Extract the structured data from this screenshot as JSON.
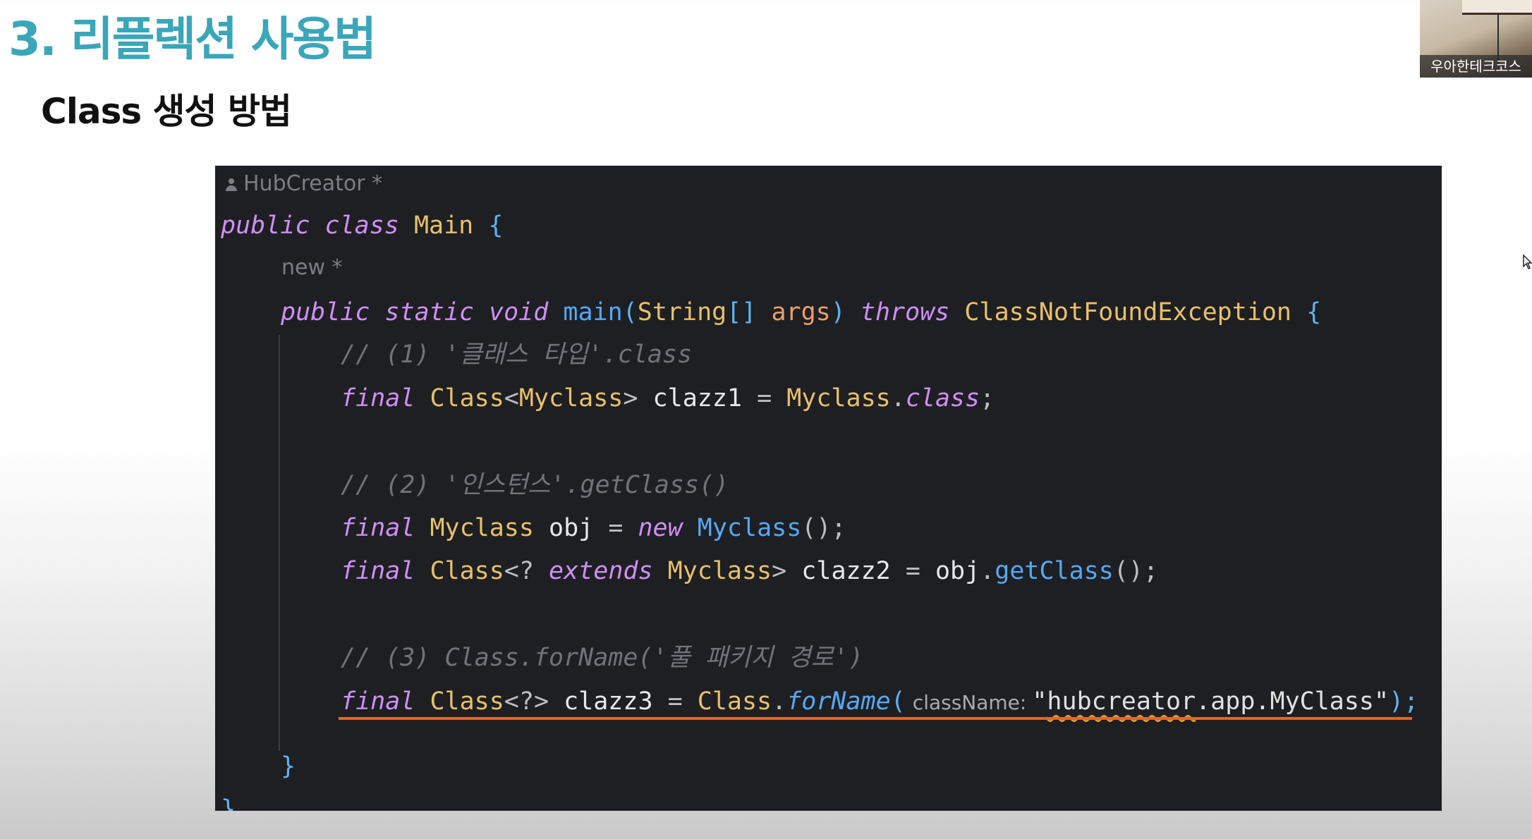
{
  "slide": {
    "title": "3. 리플렉션 사용법",
    "subtitle": "Class 생성 방법"
  },
  "webcam": {
    "label": "우아한테크코스"
  },
  "editor": {
    "author_hint": "HubCreator *",
    "method_hint": "new *",
    "line1": {
      "kw1": "public",
      "kw2": "class",
      "name": "Main",
      "brace": "{"
    },
    "line2": {
      "kw1": "public",
      "kw2": "static",
      "kw3": "void",
      "name": "main",
      "paren_open": "(",
      "type": "String",
      "arr": "[]",
      "param": "args",
      "paren_close": ")",
      "throws": "throws",
      "exc": "ClassNotFoundException",
      "brace": "{"
    },
    "comment1": "// (1) '클래스 타입'.class",
    "line3": {
      "final": "final",
      "type": "Class",
      "lt": "<",
      "generic": "Myclass",
      "gt": ">",
      "var": "clazz1",
      "eq": "=",
      "cls": "Myclass",
      "dot": ".",
      "member": "class",
      "semi": ";"
    },
    "comment2": "// (2) '인스턴스'.getClass()",
    "line4": {
      "final": "final",
      "type": "Myclass",
      "var": "obj",
      "eq": "=",
      "new": "new",
      "ctor": "Myclass",
      "call": "();"
    },
    "line5": {
      "final": "final",
      "type": "Class",
      "lt": "<?",
      "extends": "extends",
      "generic": "Myclass",
      "gt": ">",
      "var": "clazz2",
      "eq": "=",
      "obj": "obj",
      "dot": ".",
      "method": "getClass",
      "call": "();"
    },
    "comment3": "// (3) Class.forName('풀 패키지 경로')",
    "line6": {
      "final": "final",
      "type": "Class",
      "generic": "<?>",
      "var": "clazz3",
      "eq": "=",
      "cls": "Class",
      "dot": ".",
      "method": "forName",
      "paren_open": "(",
      "inlay": "className:",
      "quote_open": "\"",
      "pkg1": "hubcreator",
      "pkg_rest": ".app.MyClass",
      "quote_close": "\"",
      "end": ");"
    },
    "close_method": "}",
    "close_class": "}"
  },
  "colors": {
    "title": "#3aa6b9",
    "editor_bg": "#1e1f22",
    "keyword": "#cf8ef4",
    "class_name": "#e8c06c",
    "function": "#56a8f5",
    "comment": "#6f737a",
    "error_underline": "#e0662a"
  }
}
